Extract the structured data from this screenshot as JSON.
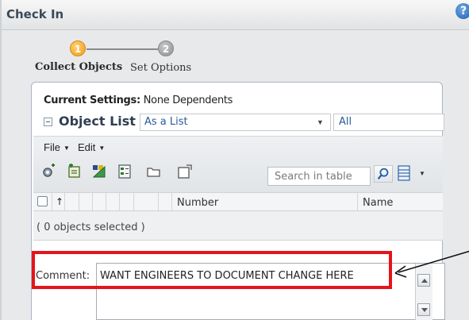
{
  "dialog": {
    "title": "Check In",
    "help_icon": "help-icon",
    "help_glyph": "?"
  },
  "wizard": {
    "steps": [
      {
        "number": "1",
        "label": "Collect Objects",
        "state": "active"
      },
      {
        "number": "2",
        "label": "Set Options",
        "state": "inactive"
      }
    ]
  },
  "settings": {
    "label": "Current Settings:",
    "value": "None Dependents"
  },
  "object_list": {
    "title": "Object List",
    "view_selected": "As a List",
    "filter_selected": "All",
    "menus": [
      {
        "label": "File"
      },
      {
        "label": "Edit"
      }
    ],
    "toolbar_icons": [
      "add-objects-icon",
      "add-to-workspace-icon",
      "collect-related-icon",
      "set-options-icon",
      "open-folder-icon",
      "new-window-icon"
    ],
    "search_placeholder": "Search in table",
    "columns": [
      {
        "label": "Number"
      },
      {
        "label": "Name"
      }
    ],
    "sort_mark": "↑",
    "selection_status": "( 0 objects selected )"
  },
  "comment": {
    "label": "Comment:",
    "value": "WANT ENGINEERS TO DOCUMENT CHANGE HERE"
  },
  "colors": {
    "highlight": "#e5141a",
    "step_active": "#f39a12",
    "step_inactive": "#8f8f8f",
    "link_text": "#2a5a9a"
  }
}
